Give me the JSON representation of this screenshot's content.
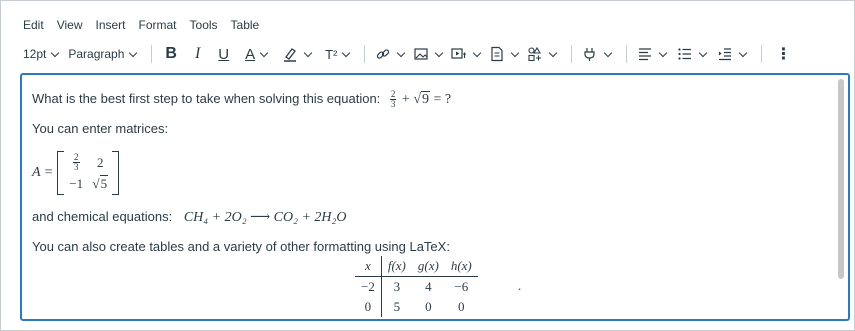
{
  "menu": [
    "Edit",
    "View",
    "Insert",
    "Format",
    "Tools",
    "Table"
  ],
  "toolbar": {
    "font_size": "12pt",
    "block_format": "Paragraph",
    "bold": "B",
    "italic": "I",
    "underline": "U",
    "text_color": "A",
    "superscript": "T²",
    "more": "⋮"
  },
  "content": {
    "question": "What is the best first step to take when solving this equation:",
    "eq_frac_num": "2",
    "eq_frac_den": "3",
    "eq_plus": "+",
    "eq_sqrt_sym": "√",
    "eq_sqrt_arg": "9",
    "eq_equals_q": "= ?",
    "matrices_intro": "You can enter matrices:",
    "matrix_label": "A =",
    "matrix": {
      "r1c1_num": "2",
      "r1c1_den": "3",
      "r1c2": "2",
      "r2c1": "−1",
      "r2c2_sym": "√",
      "r2c2_arg": "5"
    },
    "chem_intro": "and chemical equations:",
    "chem_eq": "CH₄ + 2O₂ ⟶ CO₂ + 2H₂O",
    "tables_intro": "You can also create tables and a variety of other formatting using LaTeX:",
    "table": {
      "header": [
        "x",
        "f(x)",
        "g(x)",
        "h(x)"
      ],
      "rows": [
        [
          "−2",
          "3",
          "4",
          "−6"
        ],
        [
          "0",
          "5",
          "0",
          "0"
        ]
      ],
      "trailing": "."
    }
  },
  "colors": {
    "focus_border": "#2b7abc",
    "text": "#2d3b45"
  }
}
